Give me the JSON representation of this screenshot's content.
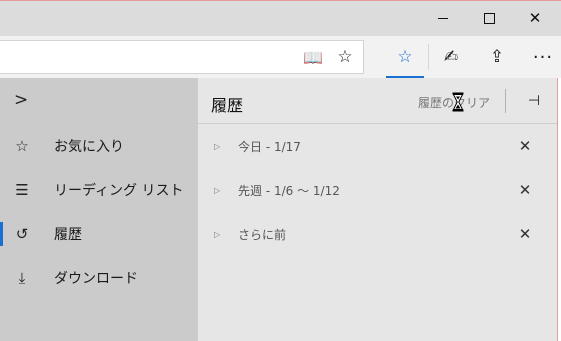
{
  "window": {
    "minimize_icon": "minimize-icon",
    "maximize_icon": "maximize-icon",
    "close_glyph": "✕"
  },
  "toolbar": {
    "reading_view_glyph": "📖",
    "favorite_star_glyph": "☆",
    "hub_glyph": "☆",
    "notes_glyph": "✍",
    "share_glyph": "⇪",
    "more_glyph": "···"
  },
  "hub_nav": {
    "expand_glyph": ">",
    "items": [
      {
        "icon": "☆",
        "label": "お気に入り"
      },
      {
        "icon": "☰",
        "label": "リーディング リスト"
      },
      {
        "icon": "↺",
        "label": "履歴"
      },
      {
        "icon": "⤓",
        "label": "ダウンロード"
      }
    ],
    "active_index": 2
  },
  "history": {
    "title": "履歴",
    "clear_label": "履歴のクリア",
    "pin_glyph": "⊣",
    "groups": [
      {
        "label": "今日 - 1/17"
      },
      {
        "label": "先週 - 1/6 ～ 1/12"
      },
      {
        "label": "さらに前"
      }
    ],
    "expand_glyph": "▷",
    "remove_glyph": "✕"
  },
  "colors": {
    "accent": "#1a6fd1",
    "nav_bg": "#cbcbcb",
    "panel_bg": "#e6e6e6",
    "titlebar_bg": "#dcdcdc"
  }
}
